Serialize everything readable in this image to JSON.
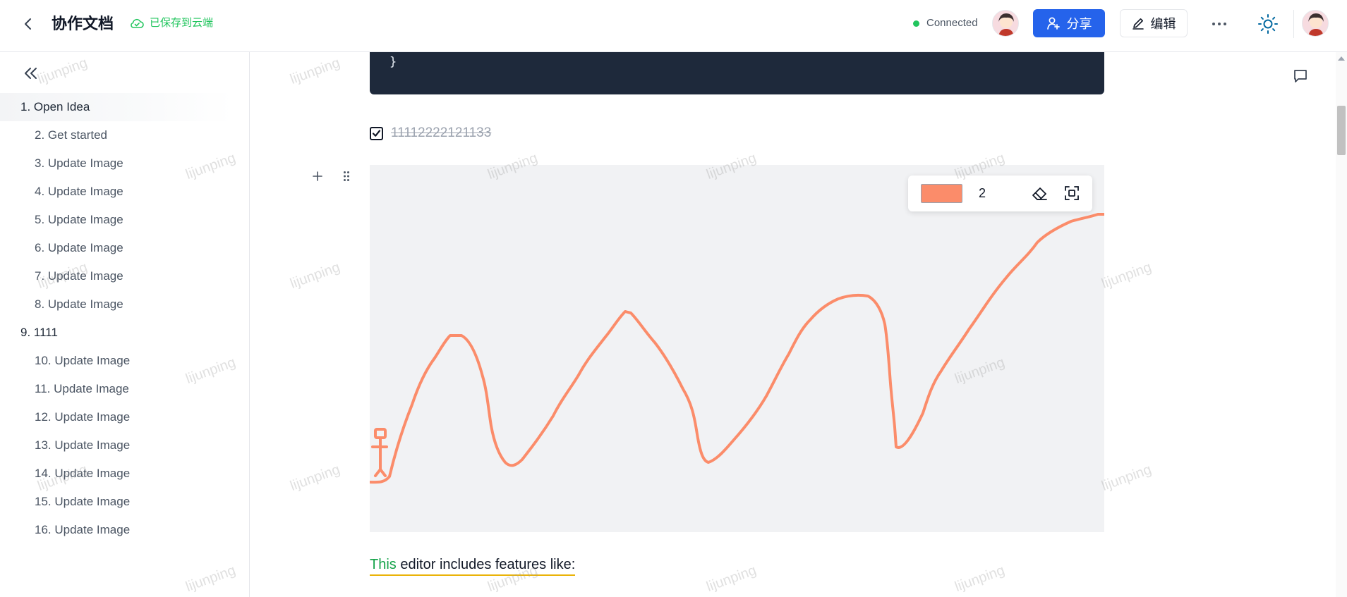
{
  "header": {
    "title": "协作文档",
    "save_status": "已保存到云端",
    "connection": "Connected",
    "share_label": "分享",
    "edit_label": "编辑"
  },
  "sidebar": {
    "items": [
      {
        "label": "1. Open Idea",
        "level": 1
      },
      {
        "label": "2. Get started",
        "level": 2
      },
      {
        "label": "3. Update Image",
        "level": 2
      },
      {
        "label": "4. Update Image",
        "level": 2
      },
      {
        "label": "5. Update Image",
        "level": 2
      },
      {
        "label": "6. Update Image",
        "level": 2
      },
      {
        "label": "7. Update Image",
        "level": 2
      },
      {
        "label": "8. Update Image",
        "level": 2
      },
      {
        "label": "9. 1111",
        "level": 1
      },
      {
        "label": "10. Update Image",
        "level": 2
      },
      {
        "label": "11. Update Image",
        "level": 2
      },
      {
        "label": "12. Update Image",
        "level": 2
      },
      {
        "label": "13. Update Image",
        "level": 2
      },
      {
        "label": "14. Update Image",
        "level": 2
      },
      {
        "label": "15. Update Image",
        "level": 2
      },
      {
        "label": "16. Update Image",
        "level": 2
      }
    ]
  },
  "editor": {
    "code_line": "}",
    "task": {
      "text": "11112222121133",
      "checked": true
    },
    "drawing": {
      "stroke_color": "#fb8c6a",
      "stroke_size": "2"
    },
    "paragraph": {
      "highlight": "This",
      "rest": " editor includes features like:"
    }
  },
  "watermark": "lijunping",
  "colors": {
    "primary": "#2563eb",
    "success": "#22c55e",
    "code_bg": "#1e293b",
    "canvas_bg": "#f1f2f4"
  }
}
